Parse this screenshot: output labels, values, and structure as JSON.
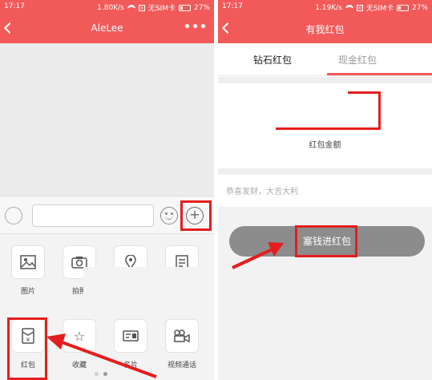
{
  "left": {
    "status": {
      "time": "17:17",
      "speed": "1.80K/s",
      "sim": "无SIM卡",
      "battery": "27%"
    },
    "title": "AleLee",
    "more": "•••",
    "plus": "+",
    "tools_row1": [
      {
        "label": "图片",
        "icon": "image-icon"
      },
      {
        "label": "拍照",
        "icon": "camera-icon"
      },
      {
        "label": "",
        "icon": "location-icon"
      },
      {
        "label": "",
        "icon": "document-icon"
      }
    ],
    "tools_row2": [
      {
        "label": "红包",
        "icon": "red-packet-icon",
        "glyph": "¥"
      },
      {
        "label": "收藏",
        "icon": "star-icon",
        "glyph": "☆"
      },
      {
        "label": "名片",
        "icon": "card-icon"
      },
      {
        "label": "视频通话",
        "icon": "video-call-icon"
      }
    ]
  },
  "right": {
    "status": {
      "time": "17:17",
      "speed": "1.19K/s",
      "sim": "无SIM卡",
      "battery": "27%"
    },
    "title": "有我红包",
    "tabs": [
      "钻石红包",
      "现金红包"
    ],
    "amount_label": "红包金额",
    "blessing": "恭喜发财，大吉大利",
    "send_button": "塞钱进红包"
  },
  "colors": {
    "accent": "#f25a5a",
    "highlight": "#e41e1e",
    "button": "#8c8c8c"
  }
}
